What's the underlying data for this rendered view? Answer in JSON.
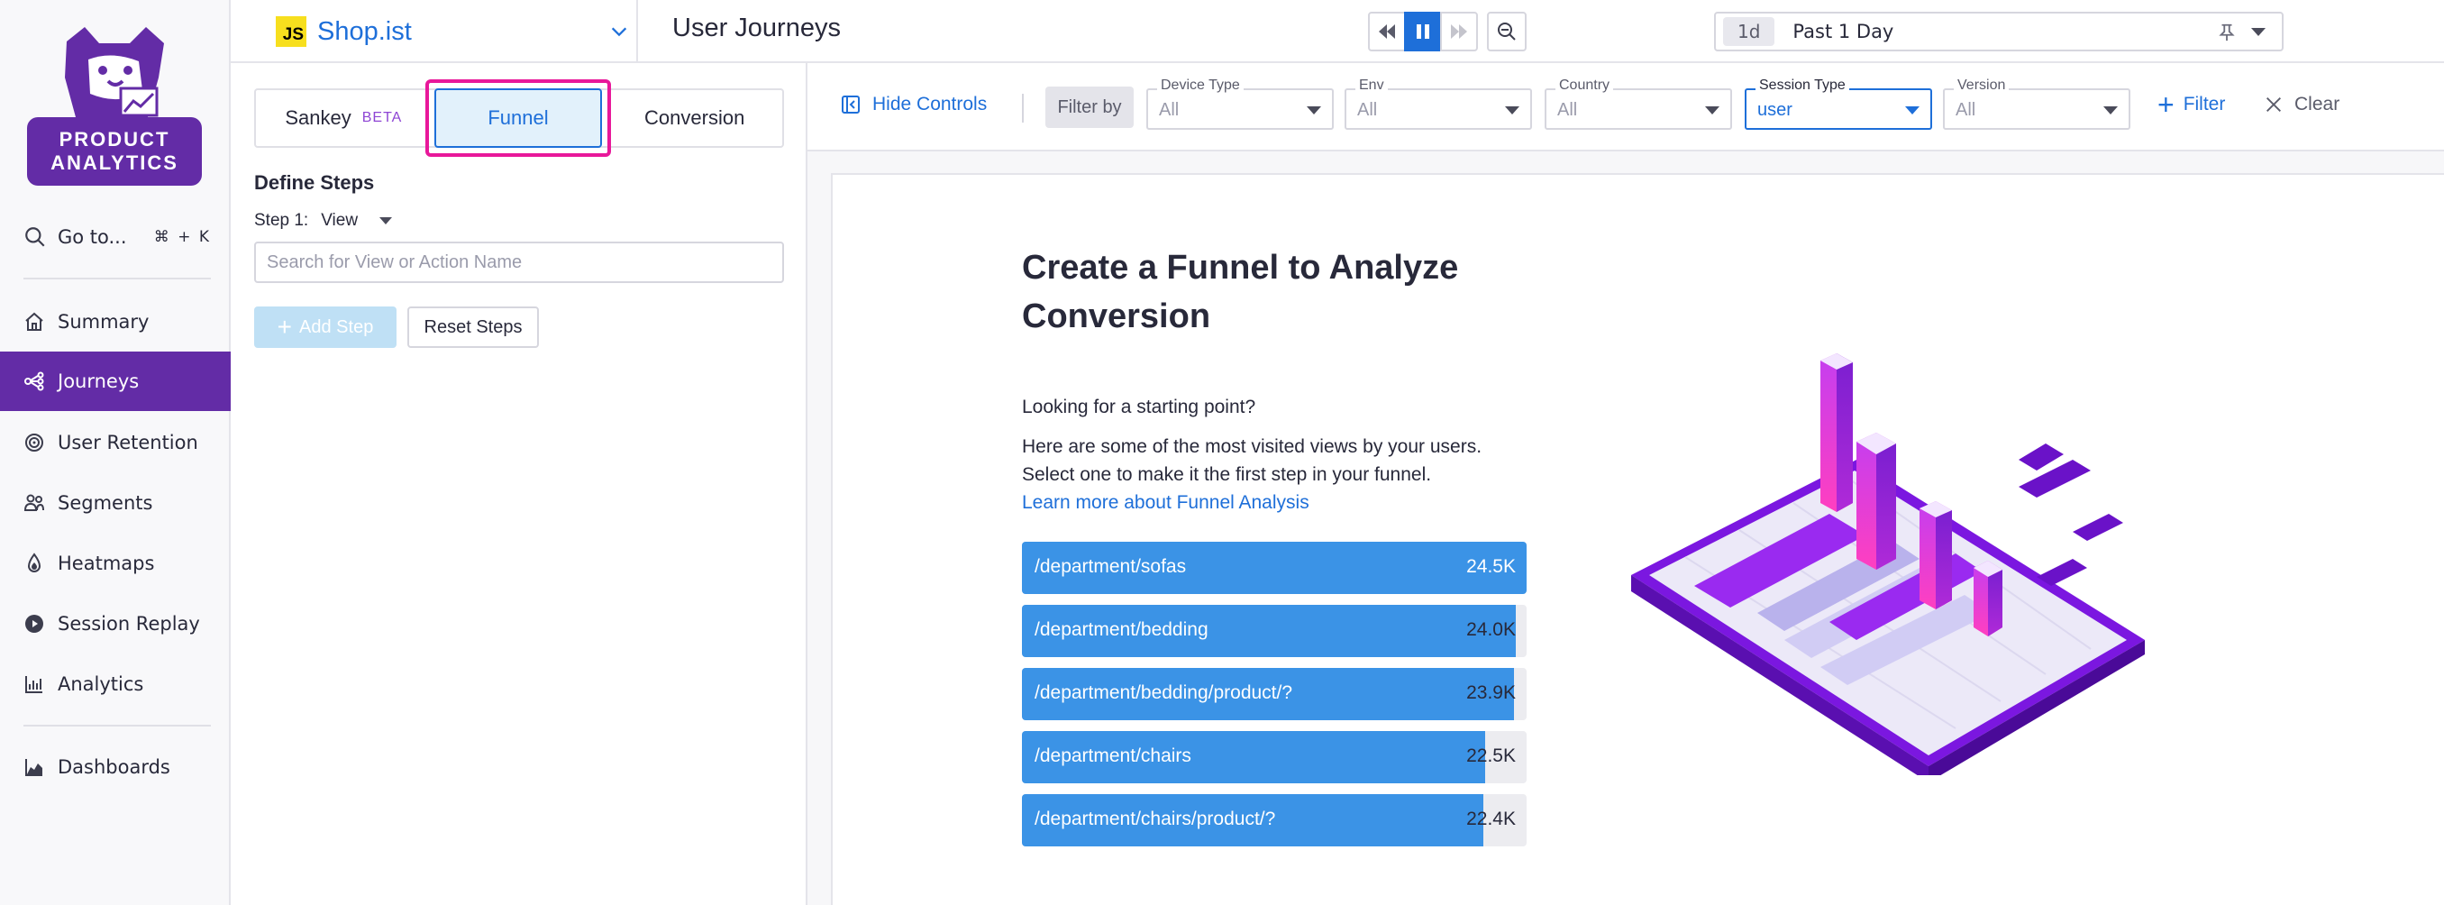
{
  "app": {
    "logo_text": "PRODUCT ANALYTICS",
    "name": "Shop.ist",
    "badge": "JS"
  },
  "header": {
    "page_title": "User Journeys",
    "time_chip": "1d",
    "time_label": "Past 1 Day"
  },
  "nav": {
    "goto_label": "Go to...",
    "goto_shortcut": "⌘ + K",
    "items": [
      {
        "label": "Summary",
        "icon": "home-icon"
      },
      {
        "label": "Journeys",
        "icon": "journeys-icon",
        "active": true
      },
      {
        "label": "User Retention",
        "icon": "retention-icon"
      },
      {
        "label": "Segments",
        "icon": "segments-icon"
      },
      {
        "label": "Heatmaps",
        "icon": "heatmap-icon"
      },
      {
        "label": "Session Replay",
        "icon": "play-icon"
      },
      {
        "label": "Analytics",
        "icon": "bar-chart-icon"
      },
      {
        "label": "Dashboards",
        "icon": "area-chart-icon"
      }
    ]
  },
  "controls": {
    "tabs": {
      "sankey": "Sankey",
      "sankey_badge": "BETA",
      "funnel": "Funnel",
      "conversion": "Conversion"
    },
    "define_steps": "Define Steps",
    "step_label": "Step 1:",
    "step_type": "View",
    "search_placeholder": "Search for View or Action Name",
    "add_step": "Add Step",
    "reset_steps": "Reset Steps"
  },
  "filterbar": {
    "hide_controls": "Hide Controls",
    "filter_by": "Filter by",
    "filters": [
      {
        "label": "Device Type",
        "value": "All"
      },
      {
        "label": "Env",
        "value": "All"
      },
      {
        "label": "Country",
        "value": "All"
      },
      {
        "label": "Session Type",
        "value": "user",
        "active": true
      },
      {
        "label": "Version",
        "value": "All"
      }
    ],
    "add_filter": "Filter",
    "clear": "Clear"
  },
  "empty_state": {
    "title": "Create a Funnel to Analyze Conversion",
    "starting_point": "Looking for a starting point?",
    "desc1": "Here are some of the most visited views by your users.",
    "desc2": "Select one to make it the first step in your funnel.",
    "learn_more": "Learn more about Funnel Analysis",
    "views": [
      {
        "path": "/department/sofas",
        "count": "24.5K",
        "fraction": 1.0
      },
      {
        "path": "/department/bedding",
        "count": "24.0K",
        "fraction": 0.979
      },
      {
        "path": "/department/bedding/product/?",
        "count": "23.9K",
        "fraction": 0.975
      },
      {
        "path": "/department/chairs",
        "count": "22.5K",
        "fraction": 0.918
      },
      {
        "path": "/department/chairs/product/?",
        "count": "22.4K",
        "fraction": 0.914
      }
    ]
  },
  "colors": {
    "brand_purple": "#632ca6",
    "link_blue": "#1e6fd9",
    "bar_blue": "#3b93e6",
    "highlight_pink": "#e8189a"
  }
}
